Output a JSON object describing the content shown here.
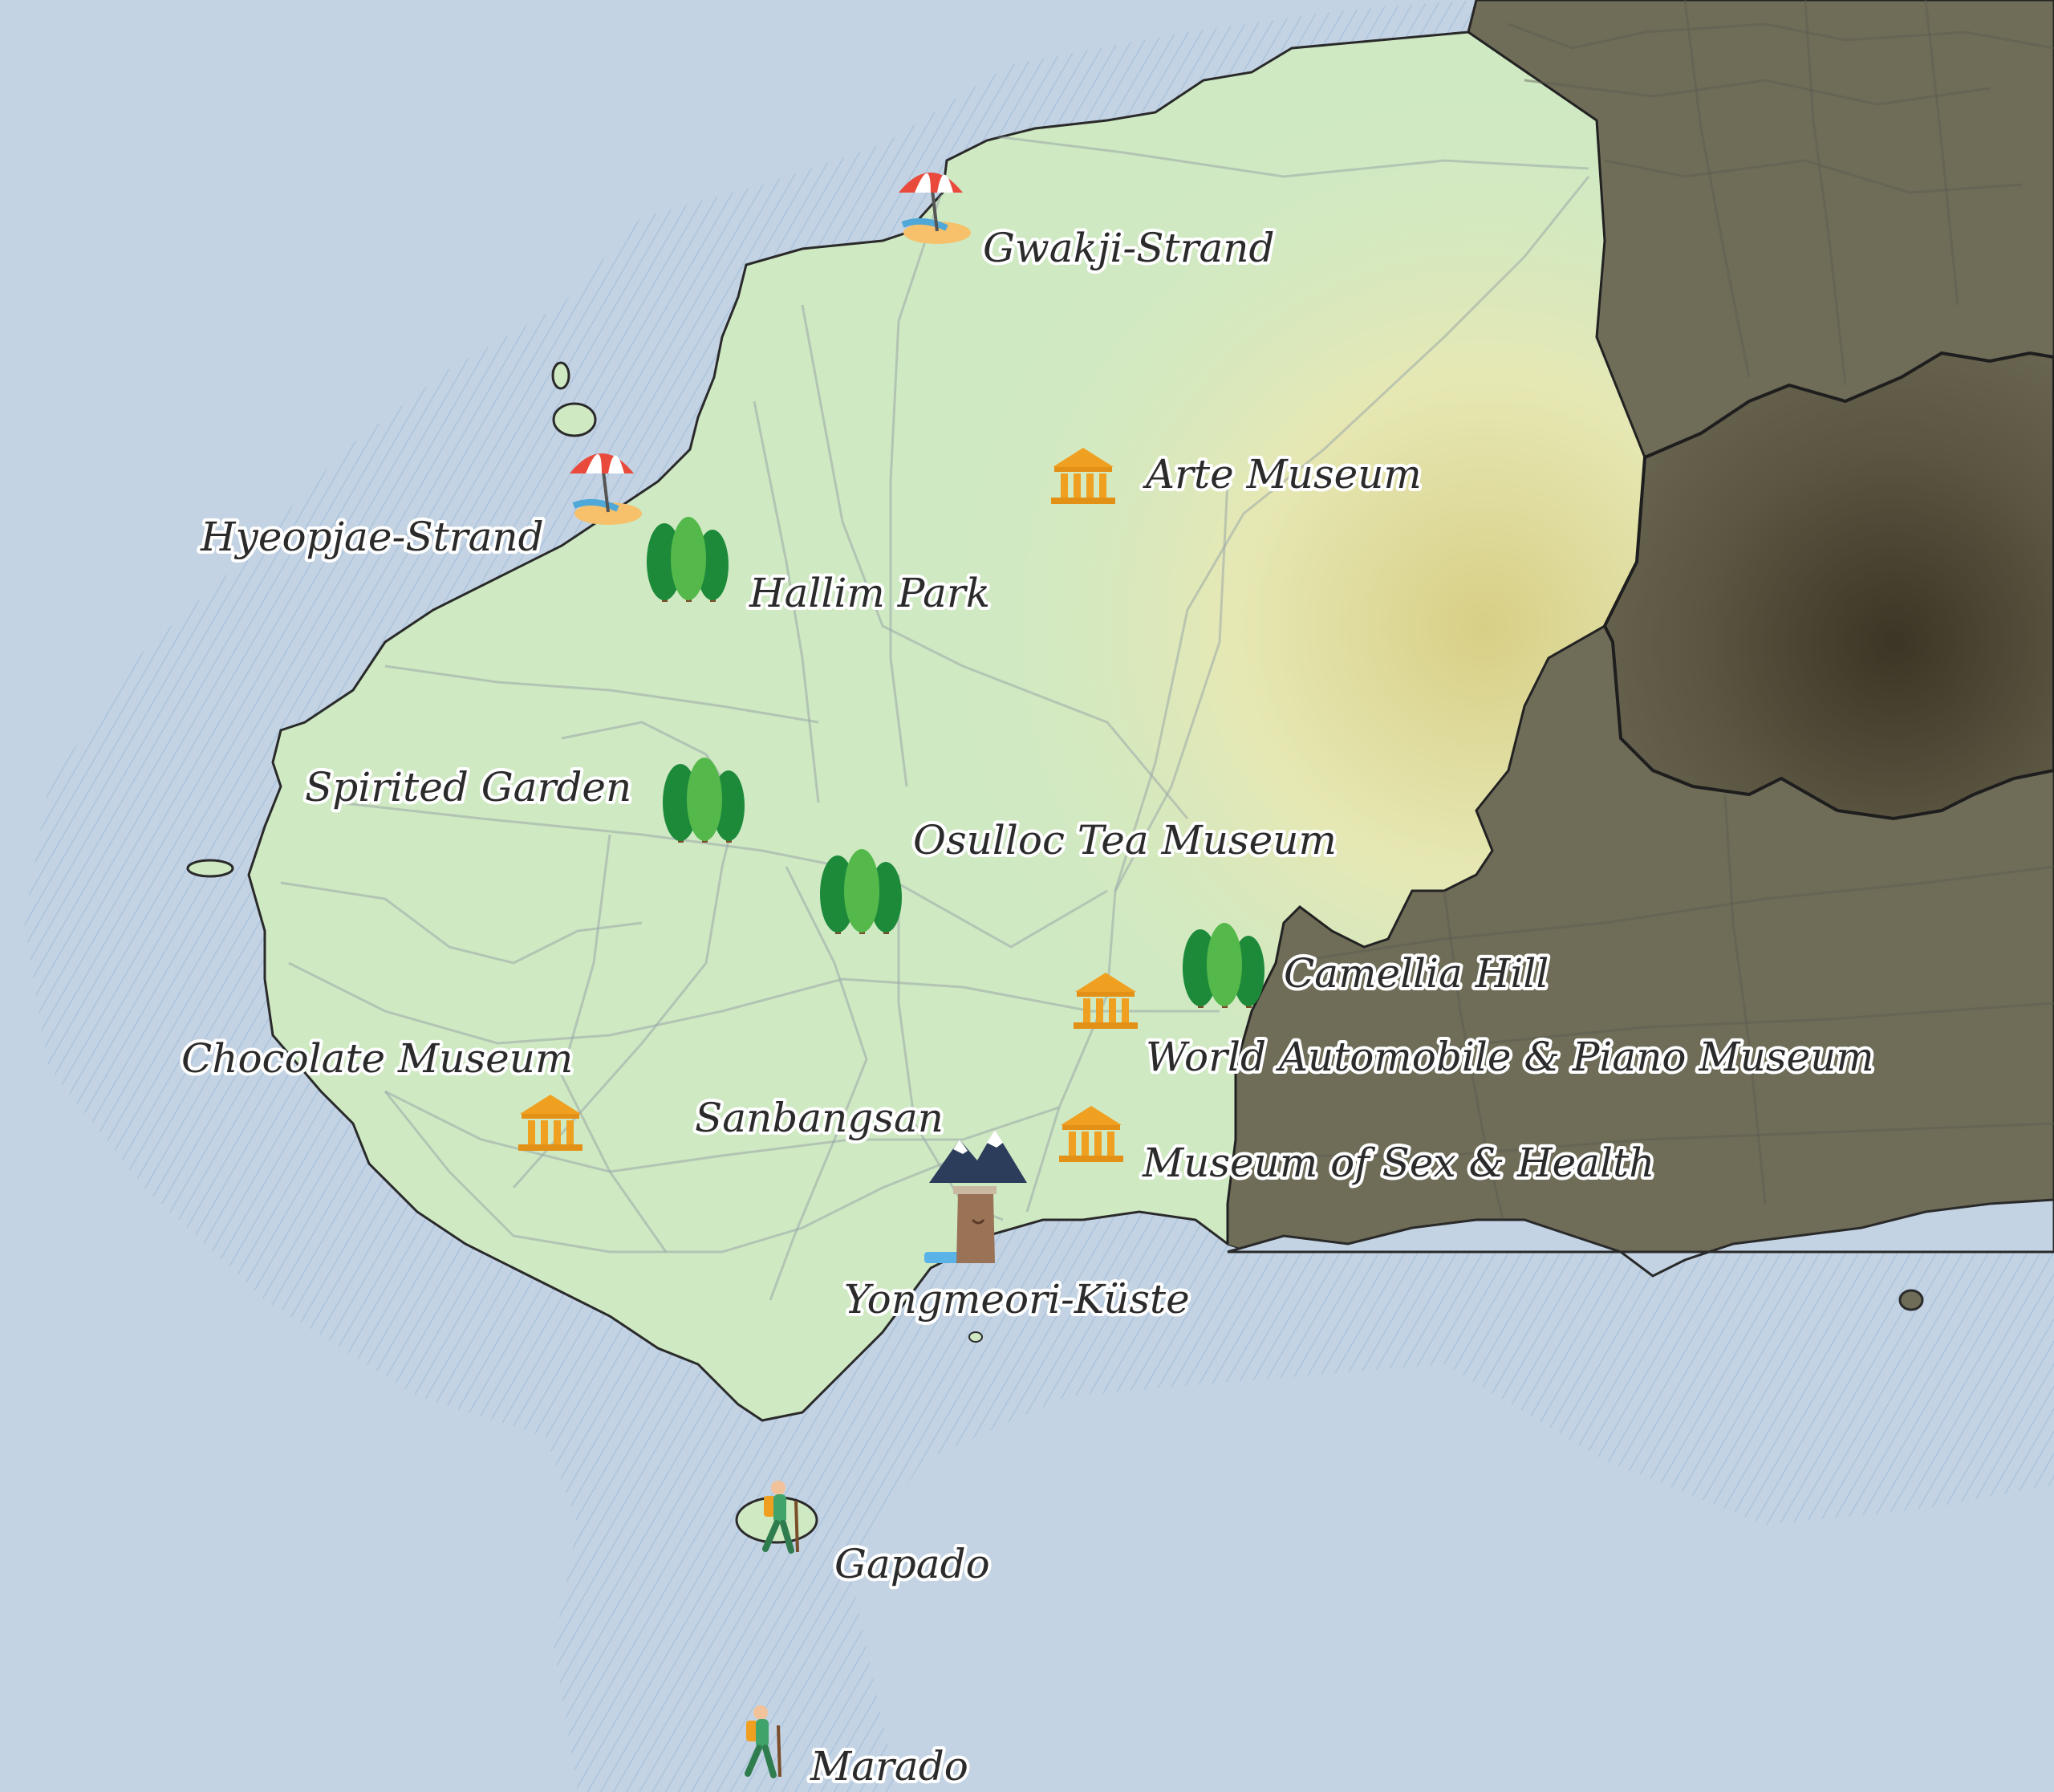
{
  "colors": {
    "sea": "#c3d3e3",
    "land": "#cfe9c3",
    "highland": "#e3e6ab",
    "shaded_region": "#6f6c58",
    "coast": "#2a2a2a"
  },
  "places": [
    {
      "id": "gwakji",
      "label": "Gwakji-Strand",
      "icon": "beach-umbrella-icon"
    },
    {
      "id": "hyeopjae",
      "label": "Hyeopjae-Strand",
      "icon": "beach-umbrella-icon"
    },
    {
      "id": "arte",
      "label": "Arte Museum",
      "icon": "museum-icon"
    },
    {
      "id": "hallim",
      "label": "Hallim Park",
      "icon": "trees-icon"
    },
    {
      "id": "spirited",
      "label": "Spirited Garden",
      "icon": "trees-icon"
    },
    {
      "id": "osulloc",
      "label": "Osulloc Tea Museum",
      "icon": "trees-icon"
    },
    {
      "id": "camellia",
      "label": "Camellia Hill",
      "icon": "trees-icon"
    },
    {
      "id": "automobile",
      "label": "World Automobile & Piano Museum",
      "icon": "museum-icon"
    },
    {
      "id": "chocolate",
      "label": "Chocolate Museum",
      "icon": "museum-icon"
    },
    {
      "id": "sanbangsan",
      "label": "Sanbangsan",
      "icon": "mountain-icon"
    },
    {
      "id": "sexhealth",
      "label": "Museum of Sex & Health",
      "icon": "museum-icon"
    },
    {
      "id": "yongmeori",
      "label": "Yongmeori-Küste",
      "icon": "cliff-icon"
    },
    {
      "id": "gapado",
      "label": "Gapado",
      "icon": "hiker-icon"
    },
    {
      "id": "marado",
      "label": "Marado",
      "icon": "hiker-icon"
    }
  ]
}
